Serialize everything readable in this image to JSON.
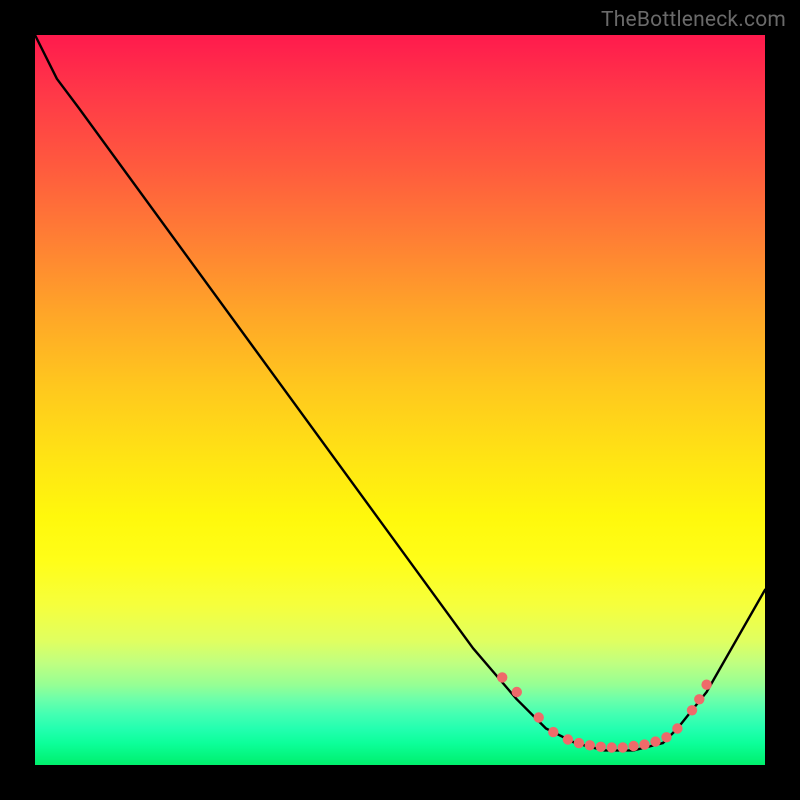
{
  "attribution": "TheBottleneck.com",
  "chart_data": {
    "type": "line",
    "title": "",
    "xlabel": "",
    "ylabel": "",
    "xlim": [
      0,
      100
    ],
    "ylim": [
      0,
      100
    ],
    "series": [
      {
        "name": "curve",
        "x": [
          0,
          3,
          6,
          60,
          66,
          70,
          74,
          78,
          82,
          86,
          88,
          92,
          100
        ],
        "y": [
          100,
          94,
          90,
          16,
          9,
          5,
          3,
          2,
          2,
          3,
          5,
          10,
          24
        ]
      }
    ],
    "markers": {
      "name": "dots",
      "x": [
        64,
        66,
        69,
        71,
        73,
        74.5,
        76,
        77.5,
        79,
        80.5,
        82,
        83.5,
        85,
        86.5,
        88,
        90,
        91,
        92
      ],
      "y": [
        12,
        10,
        6.5,
        4.5,
        3.5,
        3,
        2.7,
        2.5,
        2.4,
        2.4,
        2.6,
        2.8,
        3.2,
        3.8,
        5,
        7.5,
        9,
        11
      ]
    },
    "colors": {
      "line": "#000000",
      "markers": "#ef6a6a"
    }
  }
}
